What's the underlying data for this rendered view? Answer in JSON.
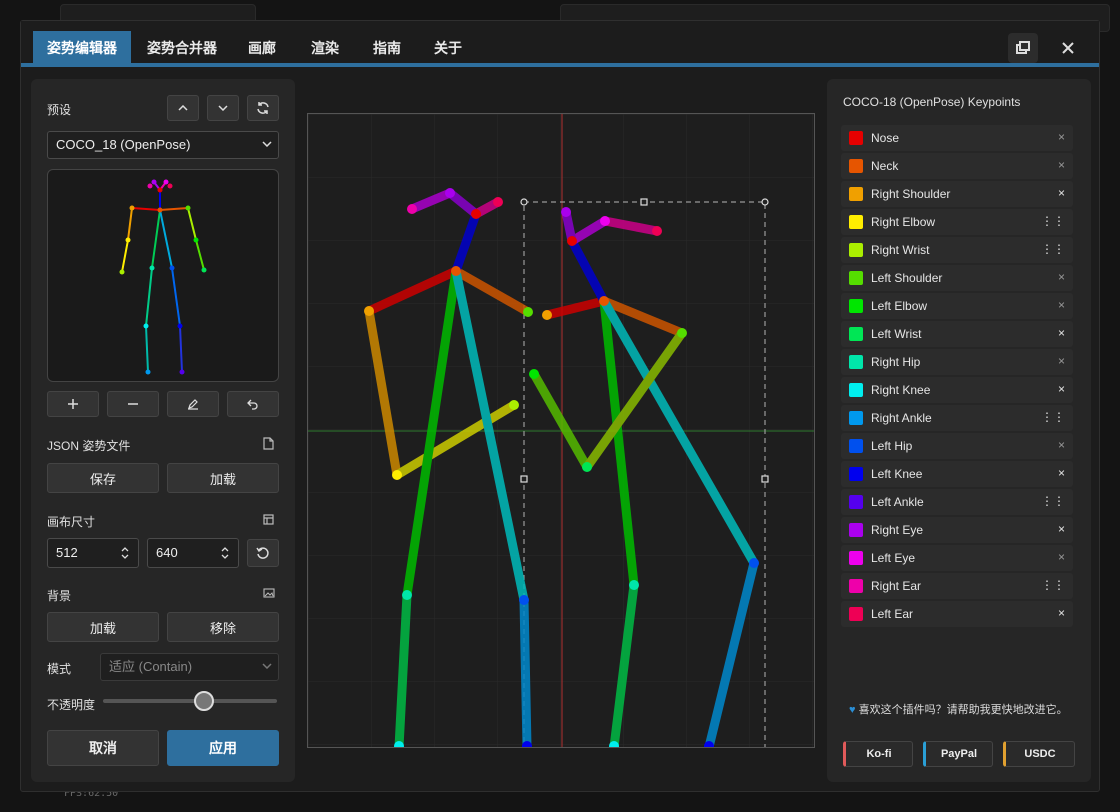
{
  "window_title": "姿势编辑器",
  "tabs": [
    {
      "label": "姿势编辑器",
      "active": true
    },
    {
      "label": "姿势合并器"
    },
    {
      "label": "画廊"
    },
    {
      "label": "渲染"
    },
    {
      "label": "指南"
    },
    {
      "label": "关于"
    }
  ],
  "sidebar": {
    "preset_label": "预设",
    "preset_value": "COCO_18 (OpenPose)",
    "json_label": "JSON 姿势文件",
    "save_label": "保存",
    "load_label": "加载",
    "canvas_size_label": "画布尺寸",
    "width": "512",
    "height": "640",
    "background_label": "背景",
    "bg_load_label": "加载",
    "bg_remove_label": "移除",
    "mode_label": "模式",
    "mode_value": "适应 (Contain)",
    "opacity_label": "不透明度",
    "opacity": 0.58,
    "cancel_label": "取消",
    "apply_label": "应用"
  },
  "keypoints": {
    "title": "COCO-18 (OpenPose) Keypoints",
    "items": [
      {
        "name": "Nose",
        "color": "#e60000",
        "action": "×"
      },
      {
        "name": "Neck",
        "color": "#e65500",
        "action": "×"
      },
      {
        "name": "Right Shoulder",
        "color": "#f0a000",
        "action": "×",
        "on": true
      },
      {
        "name": "Right Elbow",
        "color": "#ffee00",
        "action": "⋮⋮",
        "on": true
      },
      {
        "name": "Right Wrist",
        "color": "#aaee00",
        "action": "⋮⋮",
        "on": true
      },
      {
        "name": "Left Shoulder",
        "color": "#55dd00",
        "action": "×"
      },
      {
        "name": "Left Elbow",
        "color": "#00e600",
        "action": "×"
      },
      {
        "name": "Left Wrist",
        "color": "#00e655",
        "action": "×",
        "on": true
      },
      {
        "name": "Right Hip",
        "color": "#00e6aa",
        "action": "×"
      },
      {
        "name": "Right Knee",
        "color": "#00eeee",
        "action": "×",
        "on": true
      },
      {
        "name": "Right Ankle",
        "color": "#0099ee",
        "action": "⋮⋮",
        "on": true
      },
      {
        "name": "Left Hip",
        "color": "#0050ee",
        "action": "×"
      },
      {
        "name": "Left Knee",
        "color": "#0000ee",
        "action": "×",
        "on": true
      },
      {
        "name": "Left Ankle",
        "color": "#5500ee",
        "action": "⋮⋮",
        "on": true
      },
      {
        "name": "Right Eye",
        "color": "#aa00ee",
        "action": "×",
        "on": true
      },
      {
        "name": "Left Eye",
        "color": "#ee00ee",
        "action": "×"
      },
      {
        "name": "Right Ear",
        "color": "#ee00aa",
        "action": "⋮⋮",
        "on": true
      },
      {
        "name": "Left Ear",
        "color": "#ee0055",
        "action": "×",
        "on": true
      }
    ]
  },
  "footer_text": "喜欢这个插件吗？请帮助我更快地改进它。",
  "donate": [
    {
      "label": "Ko-fi",
      "color": "#e05a5a"
    },
    {
      "label": "PayPal",
      "color": "#2a9fd6"
    },
    {
      "label": "USDC",
      "color": "#e0a030"
    }
  ],
  "fps": "FPS:62.50"
}
